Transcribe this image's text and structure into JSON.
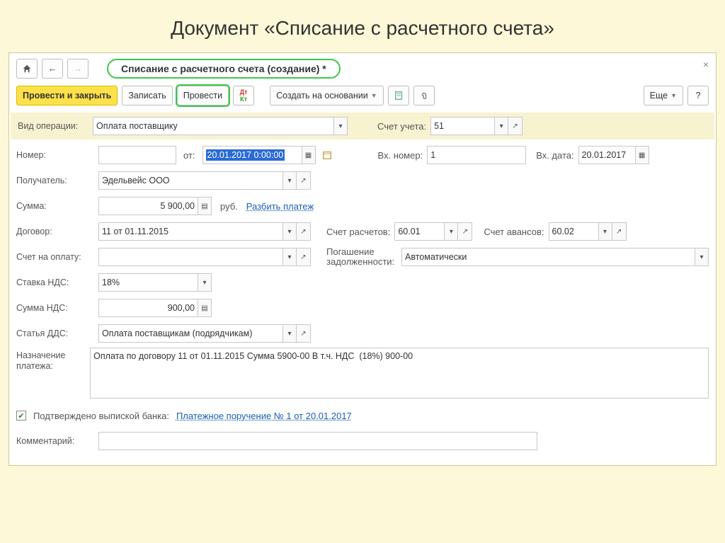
{
  "page_heading": "Документ «Списание с расчетного счета»",
  "window_title": "Списание с расчетного счета (создание) *",
  "toolbar": {
    "post_close": "Провести и закрыть",
    "save": "Записать",
    "post": "Провести",
    "create_based": "Создать на основании",
    "more": "Еще",
    "help": "?"
  },
  "op": {
    "label": "Вид операции:",
    "value": "Оплата поставщику",
    "acct_label": "Счет учета:",
    "acct_value": "51"
  },
  "num": {
    "label": "Номер:",
    "value": "",
    "date_label": "от:",
    "date_value": "20.01.2017  0:00:00",
    "in_num_label": "Вх. номер:",
    "in_num_value": "1",
    "in_date_label": "Вх. дата:",
    "in_date_value": "20.01.2017"
  },
  "recipient": {
    "label": "Получатель:",
    "value": "Эдельвейс ООО"
  },
  "sum": {
    "label": "Сумма:",
    "value": "5 900,00",
    "currency": "руб.",
    "split": "Разбить платеж"
  },
  "contract": {
    "label": "Договор:",
    "value": "11 от 01.11.2015",
    "acct_calc_label": "Счет расчетов:",
    "acct_calc_value": "60.01",
    "acct_adv_label": "Счет авансов:",
    "acct_adv_value": "60.02"
  },
  "invoice": {
    "label": "Счет на оплату:",
    "value": "",
    "debt_label1": "Погашение",
    "debt_label2": "задолженности:",
    "debt_value": "Автоматически"
  },
  "vat_rate": {
    "label": "Ставка НДС:",
    "value": "18%"
  },
  "vat_sum": {
    "label": "Сумма НДС:",
    "value": "900,00"
  },
  "dds": {
    "label": "Статья ДДС:",
    "value": "Оплата поставщикам (подрядчикам)"
  },
  "purpose": {
    "label1": "Назначение",
    "label2": "платежа:",
    "value": "Оплата по договору 11 от 01.11.2015 Сумма 5900-00 В т.ч. НДС  (18%) 900-00"
  },
  "bank": {
    "label": "Подтверждено выпиской банка:",
    "link": "Платежное поручение № 1 от 20.01.2017"
  },
  "comment": {
    "label": "Комментарий:",
    "value": ""
  }
}
